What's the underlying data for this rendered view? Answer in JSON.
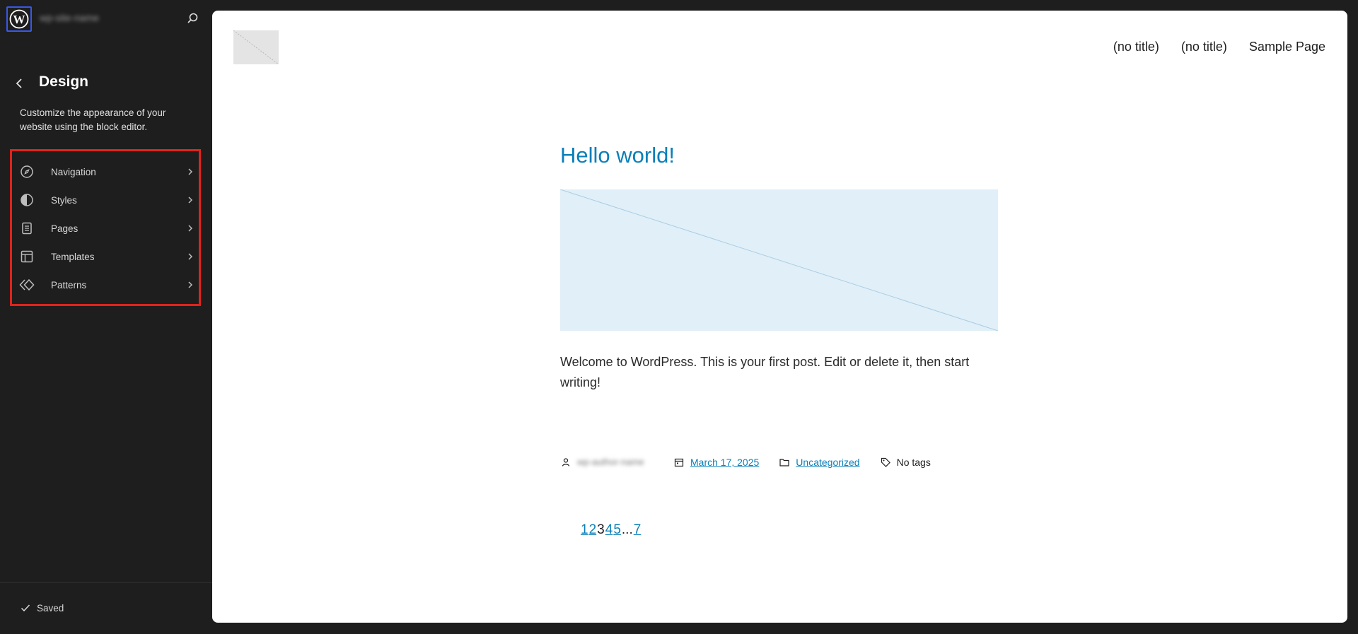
{
  "sidebar": {
    "site_name": "wp-site-name",
    "title": "Design",
    "description": "Customize the appearance of your website using the block editor.",
    "menu": [
      {
        "label": "Navigation",
        "icon": "navigation-compass-icon"
      },
      {
        "label": "Styles",
        "icon": "styles-half-circle-icon"
      },
      {
        "label": "Pages",
        "icon": "pages-document-icon"
      },
      {
        "label": "Templates",
        "icon": "templates-layout-icon"
      },
      {
        "label": "Patterns",
        "icon": "patterns-diamond-icon"
      }
    ],
    "status": "Saved"
  },
  "site": {
    "nav": [
      "(no title)",
      "(no title)",
      "Sample Page"
    ]
  },
  "post": {
    "title": "Hello world!",
    "body": "Welcome to WordPress. This is your first post. Edit or delete it, then start writing!",
    "author": "wp-author-name",
    "date": "March 17, 2025",
    "category": "Uncategorized",
    "tags": "No tags"
  },
  "pagination": {
    "items": [
      "1",
      "2",
      "3",
      "4",
      "5",
      "...",
      "7"
    ],
    "current": "3"
  },
  "colors": {
    "accent": "#0a7fb8",
    "highlight_border": "#e0231c",
    "admin_bg": "#1e1e1e",
    "wp_blue": "#3858e9"
  }
}
